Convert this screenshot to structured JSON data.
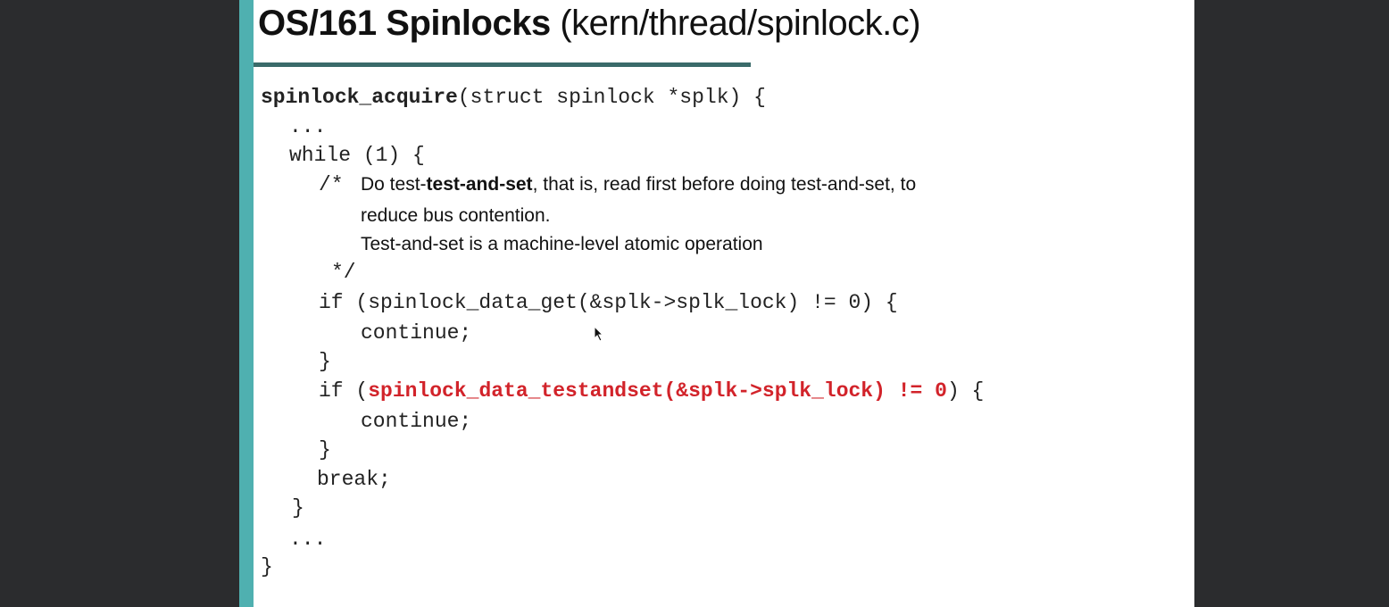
{
  "slide": {
    "title_bold": "OS/161 Spinlocks",
    "title_rest": " (kern/thread/spinlock.c)"
  },
  "code": {
    "func_name": "spinlock_acquire",
    "func_sig": "(struct spinlock *splk) {",
    "ellipsis_top": "...",
    "while_line": "while (1) {",
    "comment_open": "/*",
    "comment_l1_a": "Do test-",
    "comment_l1_b": "test-and-set",
    "comment_l1_c": ", that is, read first before doing test-and-set, to",
    "comment_l2": "reduce bus contention.",
    "comment_l3": "Test-and-set is a machine-level atomic operation",
    "comment_close": "*/",
    "if1": "if (spinlock_data_get(&splk->splk_lock) != 0) {",
    "continue1": "continue;",
    "close_if1": "}",
    "if2_a": "if (",
    "if2_b": "spinlock_data_testandset(&splk->splk_lock) != 0",
    "if2_c": ") {",
    "continue2": "continue;",
    "close_if2": "}",
    "break_line": "break;",
    "close_while": "}",
    "ellipsis_bottom": "...",
    "close_func": "}"
  }
}
